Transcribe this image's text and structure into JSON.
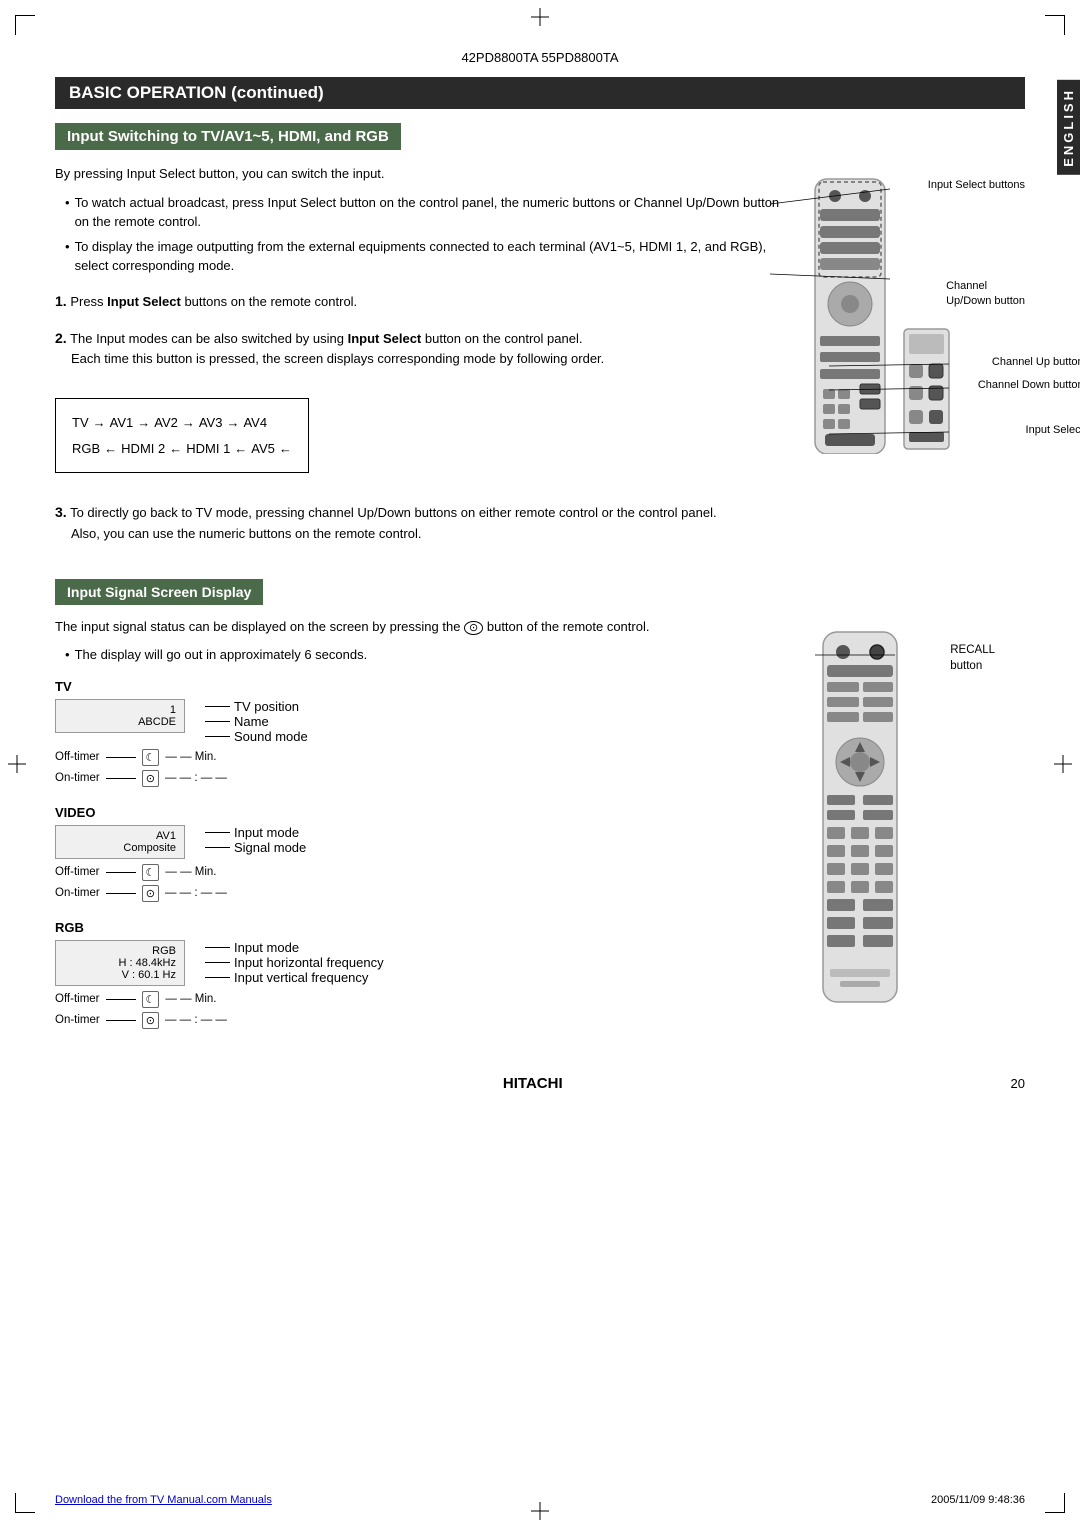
{
  "page": {
    "title": "42PD8800TA  55PD8800TA",
    "page_number": "20",
    "brand": "HITACHI",
    "footer_link": "Download the from TV Manual.com Manuals",
    "footer_date": "2005/11/09  9:48:36"
  },
  "sections": {
    "main_header": "BASIC OPERATION (continued)",
    "sub_header_1": "Input Switching to TV/AV1~5, HDMI, and RGB",
    "sub_header_2": "Input Signal Screen Display"
  },
  "input_switching": {
    "intro": "By pressing Input Select button, you can switch the input.",
    "bullets": [
      "To watch actual broadcast, press Input Select button on the control panel, the numeric buttons or Channel Up/Down button on the remote control.",
      "To display the image outputting from the external equipments connected to each terminal (AV1~5, HDMI 1, 2, and RGB), select corresponding mode."
    ],
    "step1": {
      "number": "1.",
      "text_before": "Press ",
      "bold": "Input Select",
      "text_after": " buttons on the remote control."
    },
    "step2": {
      "number": "2.",
      "text_before": "The Input modes can be also switched by using ",
      "bold": "Input Select",
      "text_after": " button on the control panel.",
      "detail": "Each time this button is pressed, the screen displays corresponding mode by following order."
    },
    "step3": {
      "number": "3.",
      "text": "To directly go back to TV mode, pressing channel Up/Down buttons on either remote control or the control panel.\n Also, you can use the numeric buttons on the remote control."
    },
    "flow": {
      "row1": [
        "TV",
        "AV1",
        "AV2",
        "AV3",
        "AV4"
      ],
      "row2": [
        "RGB",
        "HDMI 2",
        "HDMI 1",
        "AV5"
      ]
    },
    "remote_labels": {
      "input_select_buttons": "Input Select buttons",
      "channel_updown": "Channel\nUp/Down button",
      "channel_up": "Channel Up button",
      "channel_down": "Channel Down button",
      "input_select": "Input Select"
    }
  },
  "signal_display": {
    "intro1": "The input signal status can be displayed on the screen by pressing the",
    "intro2": "button of the remote control.",
    "bullet": "The display will go out in approximately 6 seconds.",
    "recall_label": "RECALL\nbutton",
    "tv_section": {
      "label": "TV",
      "screen_line1": "1",
      "screen_line2": "ABCDE",
      "annotations": {
        "tv_position": "TV position",
        "name": "Name",
        "sound_mode": "Sound mode"
      },
      "off_timer": "Off-timer",
      "on_timer": "On-timer",
      "off_timer_val": "— — Min.",
      "on_timer_val": "— — : — —"
    },
    "video_section": {
      "label": "VIDEO",
      "screen_line1": "AV1",
      "screen_line2": "Composite",
      "annotations": {
        "input_mode": "Input mode",
        "signal_mode": "Signal mode"
      },
      "off_timer": "Off-timer",
      "on_timer": "On-timer",
      "off_timer_val": "— — Min.",
      "on_timer_val": "— — : — —"
    },
    "rgb_section": {
      "label": "RGB",
      "screen_line1": "RGB",
      "screen_line2": "H :  48.4kHz",
      "screen_line3": "V :  60.1 Hz",
      "annotations": {
        "input_mode": "Input mode",
        "h_freq": "Input horizontal frequency",
        "v_freq": "Input vertical frequency"
      },
      "off_timer": "Off-timer",
      "on_timer": "On-timer",
      "off_timer_val": "— — Min.",
      "on_timer_val": "— — : — —"
    }
  },
  "english_sidebar": "ENGLISH"
}
